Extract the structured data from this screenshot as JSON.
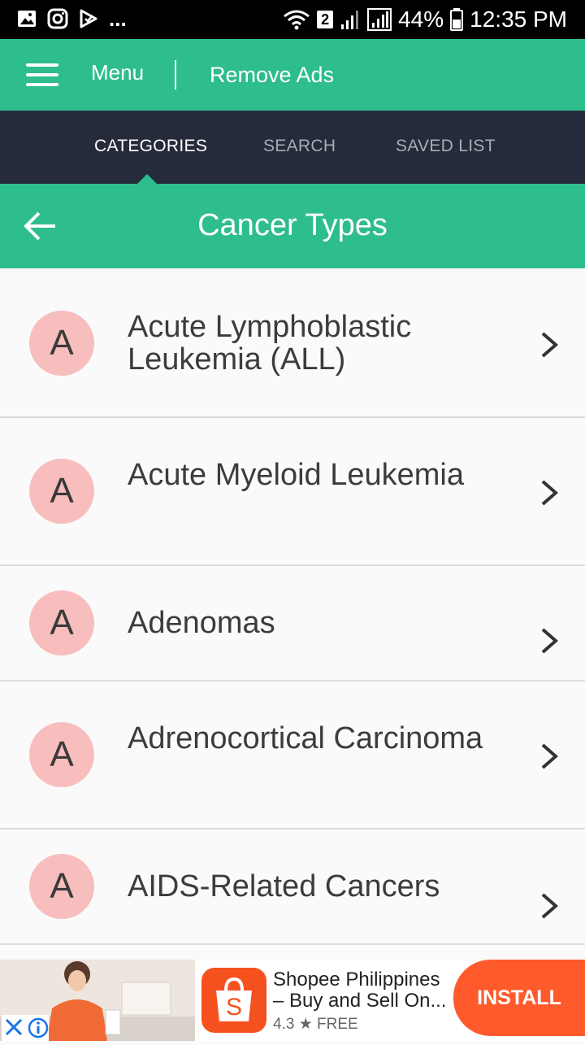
{
  "status_bar": {
    "notification_overflow": "...",
    "sim_number": "2",
    "battery": "44%",
    "time": "12:35 PM"
  },
  "app_bar": {
    "menu_label": "Menu",
    "remove_ads_label": "Remove Ads"
  },
  "tabs": [
    {
      "label": "CATEGORIES",
      "active": true
    },
    {
      "label": "SEARCH",
      "active": false
    },
    {
      "label": "SAVED LIST",
      "active": false
    }
  ],
  "section": {
    "title": "Cancer Types"
  },
  "list": {
    "items": [
      {
        "letter": "A",
        "title": "Acute Lymphoblastic Leukemia (ALL)"
      },
      {
        "letter": "A",
        "title": "Acute Myeloid Leukemia"
      },
      {
        "letter": "A",
        "title": "Adenomas"
      },
      {
        "letter": "A",
        "title": "Adrenocortical Carcinoma"
      },
      {
        "letter": "A",
        "title": "AIDS-Related Cancers"
      }
    ]
  },
  "ad": {
    "title": "Shopee Philippines – Buy and Sell On...",
    "rating": "4.3",
    "price": "FREE",
    "install_label": "INSTALL",
    "icons": [
      "close-icon",
      "info-icon",
      "star-icon",
      "shopee-bag-icon"
    ]
  },
  "colors": {
    "primary_green": "#2ebd8c",
    "tab_bar": "#252b3a",
    "avatar_pink": "#f8bdbd",
    "install_orange": "#ff5a2c"
  }
}
